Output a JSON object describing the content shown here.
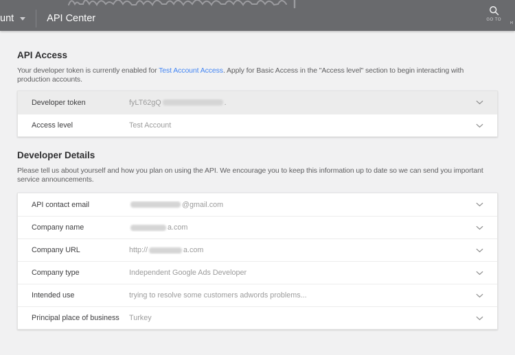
{
  "header": {
    "account_fragment": "unt",
    "page_title": "API Center",
    "goto_label": "GO TO",
    "right_fragment": "R"
  },
  "icons": {
    "caret_down": "triangle-down",
    "search": "magnifier",
    "chevron_down": "v-chevron",
    "scribble": "handwriting-overlay"
  },
  "colors": {
    "appbar_bg": "#696a6d",
    "page_bg": "#f1f1f2",
    "link_blue": "#4285f4",
    "row_highlight": "#ececec",
    "value_gray": "#9b9b9b"
  },
  "api_access": {
    "heading": "API Access",
    "desc_before_link": "Your developer token is currently enabled for",
    "link_text": "Test Account Access",
    "desc_after_link": ". Apply for Basic Access in the \"Access level\" section to begin interacting with production accounts.",
    "rows": [
      {
        "label": "Developer token",
        "value_prefix": "fyLT62gQ",
        "value_redacted": "true",
        "value_suffix": "."
      },
      {
        "label": "Access level",
        "value": "Test Account"
      }
    ]
  },
  "developer_details": {
    "heading": "Developer Details",
    "description": "Please tell us about yourself and how you plan on using the API. We encourage you to keep this information up to date so we can send you important service announcements.",
    "rows": [
      {
        "label": "API contact email",
        "value_redacted": "true",
        "value_suffix": "@gmail.com"
      },
      {
        "label": "Company name",
        "value_redacted": "true",
        "value_suffix": "a.com"
      },
      {
        "label": "Company URL",
        "value_prefix": "http://",
        "value_redacted": "true",
        "value_suffix": "a.com"
      },
      {
        "label": "Company type",
        "value": "Independent Google Ads Developer"
      },
      {
        "label": "Intended use",
        "value": "trying to resolve some customers adwords problems..."
      },
      {
        "label": "Principal place of business",
        "value": "Turkey"
      }
    ]
  }
}
